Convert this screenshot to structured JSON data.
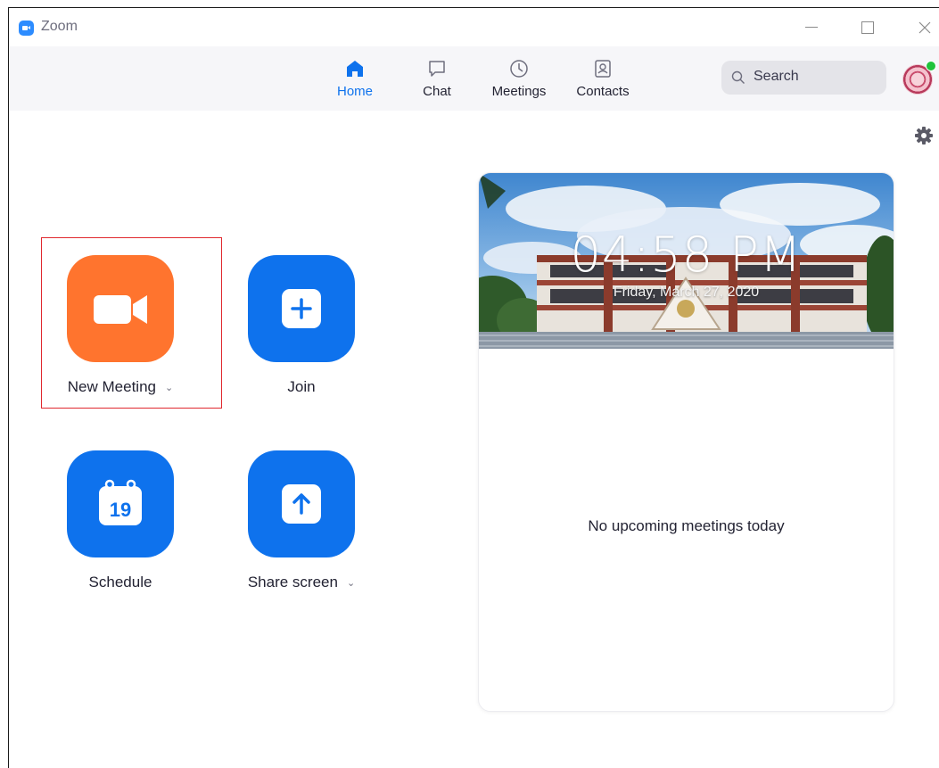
{
  "window": {
    "app_title": "Zoom"
  },
  "nav": {
    "items": [
      {
        "label": "Home",
        "icon": "home-icon",
        "active": true
      },
      {
        "label": "Chat",
        "icon": "chat-bubble-icon"
      },
      {
        "label": "Meetings",
        "icon": "clock-icon"
      },
      {
        "label": "Contacts",
        "icon": "contact-card-icon"
      }
    ]
  },
  "search": {
    "placeholder": "Search"
  },
  "actions": {
    "new_meeting": {
      "label": "New Meeting",
      "icon": "video-camera-icon",
      "color": "#ff742e"
    },
    "join": {
      "label": "Join",
      "icon": "plus-icon",
      "color": "#0e72ed"
    },
    "schedule": {
      "label": "Schedule",
      "icon": "calendar-icon",
      "calendar_day": "19",
      "color": "#0e72ed"
    },
    "share_screen": {
      "label": "Share screen",
      "icon": "share-arrow-up-icon",
      "color": "#0e72ed"
    }
  },
  "panel": {
    "time": "04:58 PM",
    "date": "Friday, March 27, 2020",
    "empty_message": "No upcoming meetings today"
  },
  "colors": {
    "accent": "#0e72ed",
    "highlight_border": "#e0282e",
    "presence": "#20c33b"
  }
}
